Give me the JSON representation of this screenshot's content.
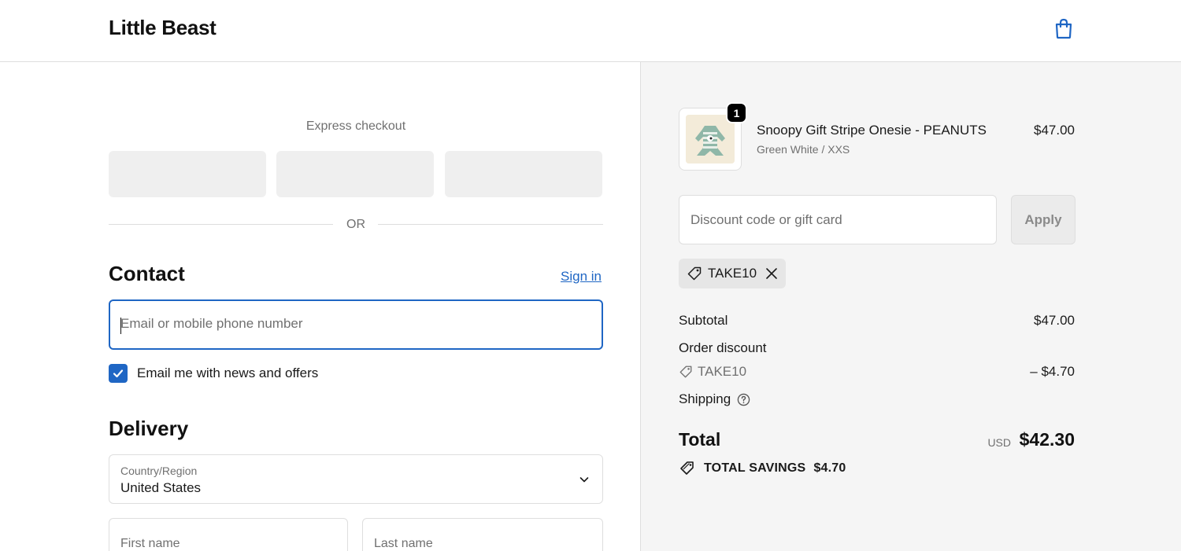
{
  "header": {
    "brand": "Little Beast",
    "cart_icon": "shopping-bag-icon",
    "accent_color": "#1f66c4"
  },
  "express": {
    "title": "Express checkout",
    "divider_text": "OR"
  },
  "contact": {
    "title": "Contact",
    "sign_in": "Sign in",
    "email_placeholder": "Email or mobile phone number",
    "email_value": "",
    "newsletter_label": "Email me with news and offers",
    "newsletter_checked": true
  },
  "delivery": {
    "title": "Delivery",
    "country_label": "Country/Region",
    "country_value": "United States",
    "first_name_placeholder": "First name",
    "last_name_placeholder": "Last name"
  },
  "order": {
    "item": {
      "quantity": "1",
      "name": "Snoopy Gift Stripe Onesie - PEANUTS",
      "variant": "Green White / XXS",
      "price": "$47.00"
    },
    "discount_placeholder": "Discount code or gift card",
    "apply_label": "Apply",
    "applied_code": "TAKE10",
    "subtotal_label": "Subtotal",
    "subtotal_value": "$47.00",
    "order_discount_label": "Order discount",
    "discount_code": "TAKE10",
    "discount_value": "– $4.70",
    "shipping_label": "Shipping",
    "total_label": "Total",
    "total_currency": "USD",
    "total_value": "$42.30",
    "savings_label": "TOTAL SAVINGS",
    "savings_value": "$4.70"
  }
}
